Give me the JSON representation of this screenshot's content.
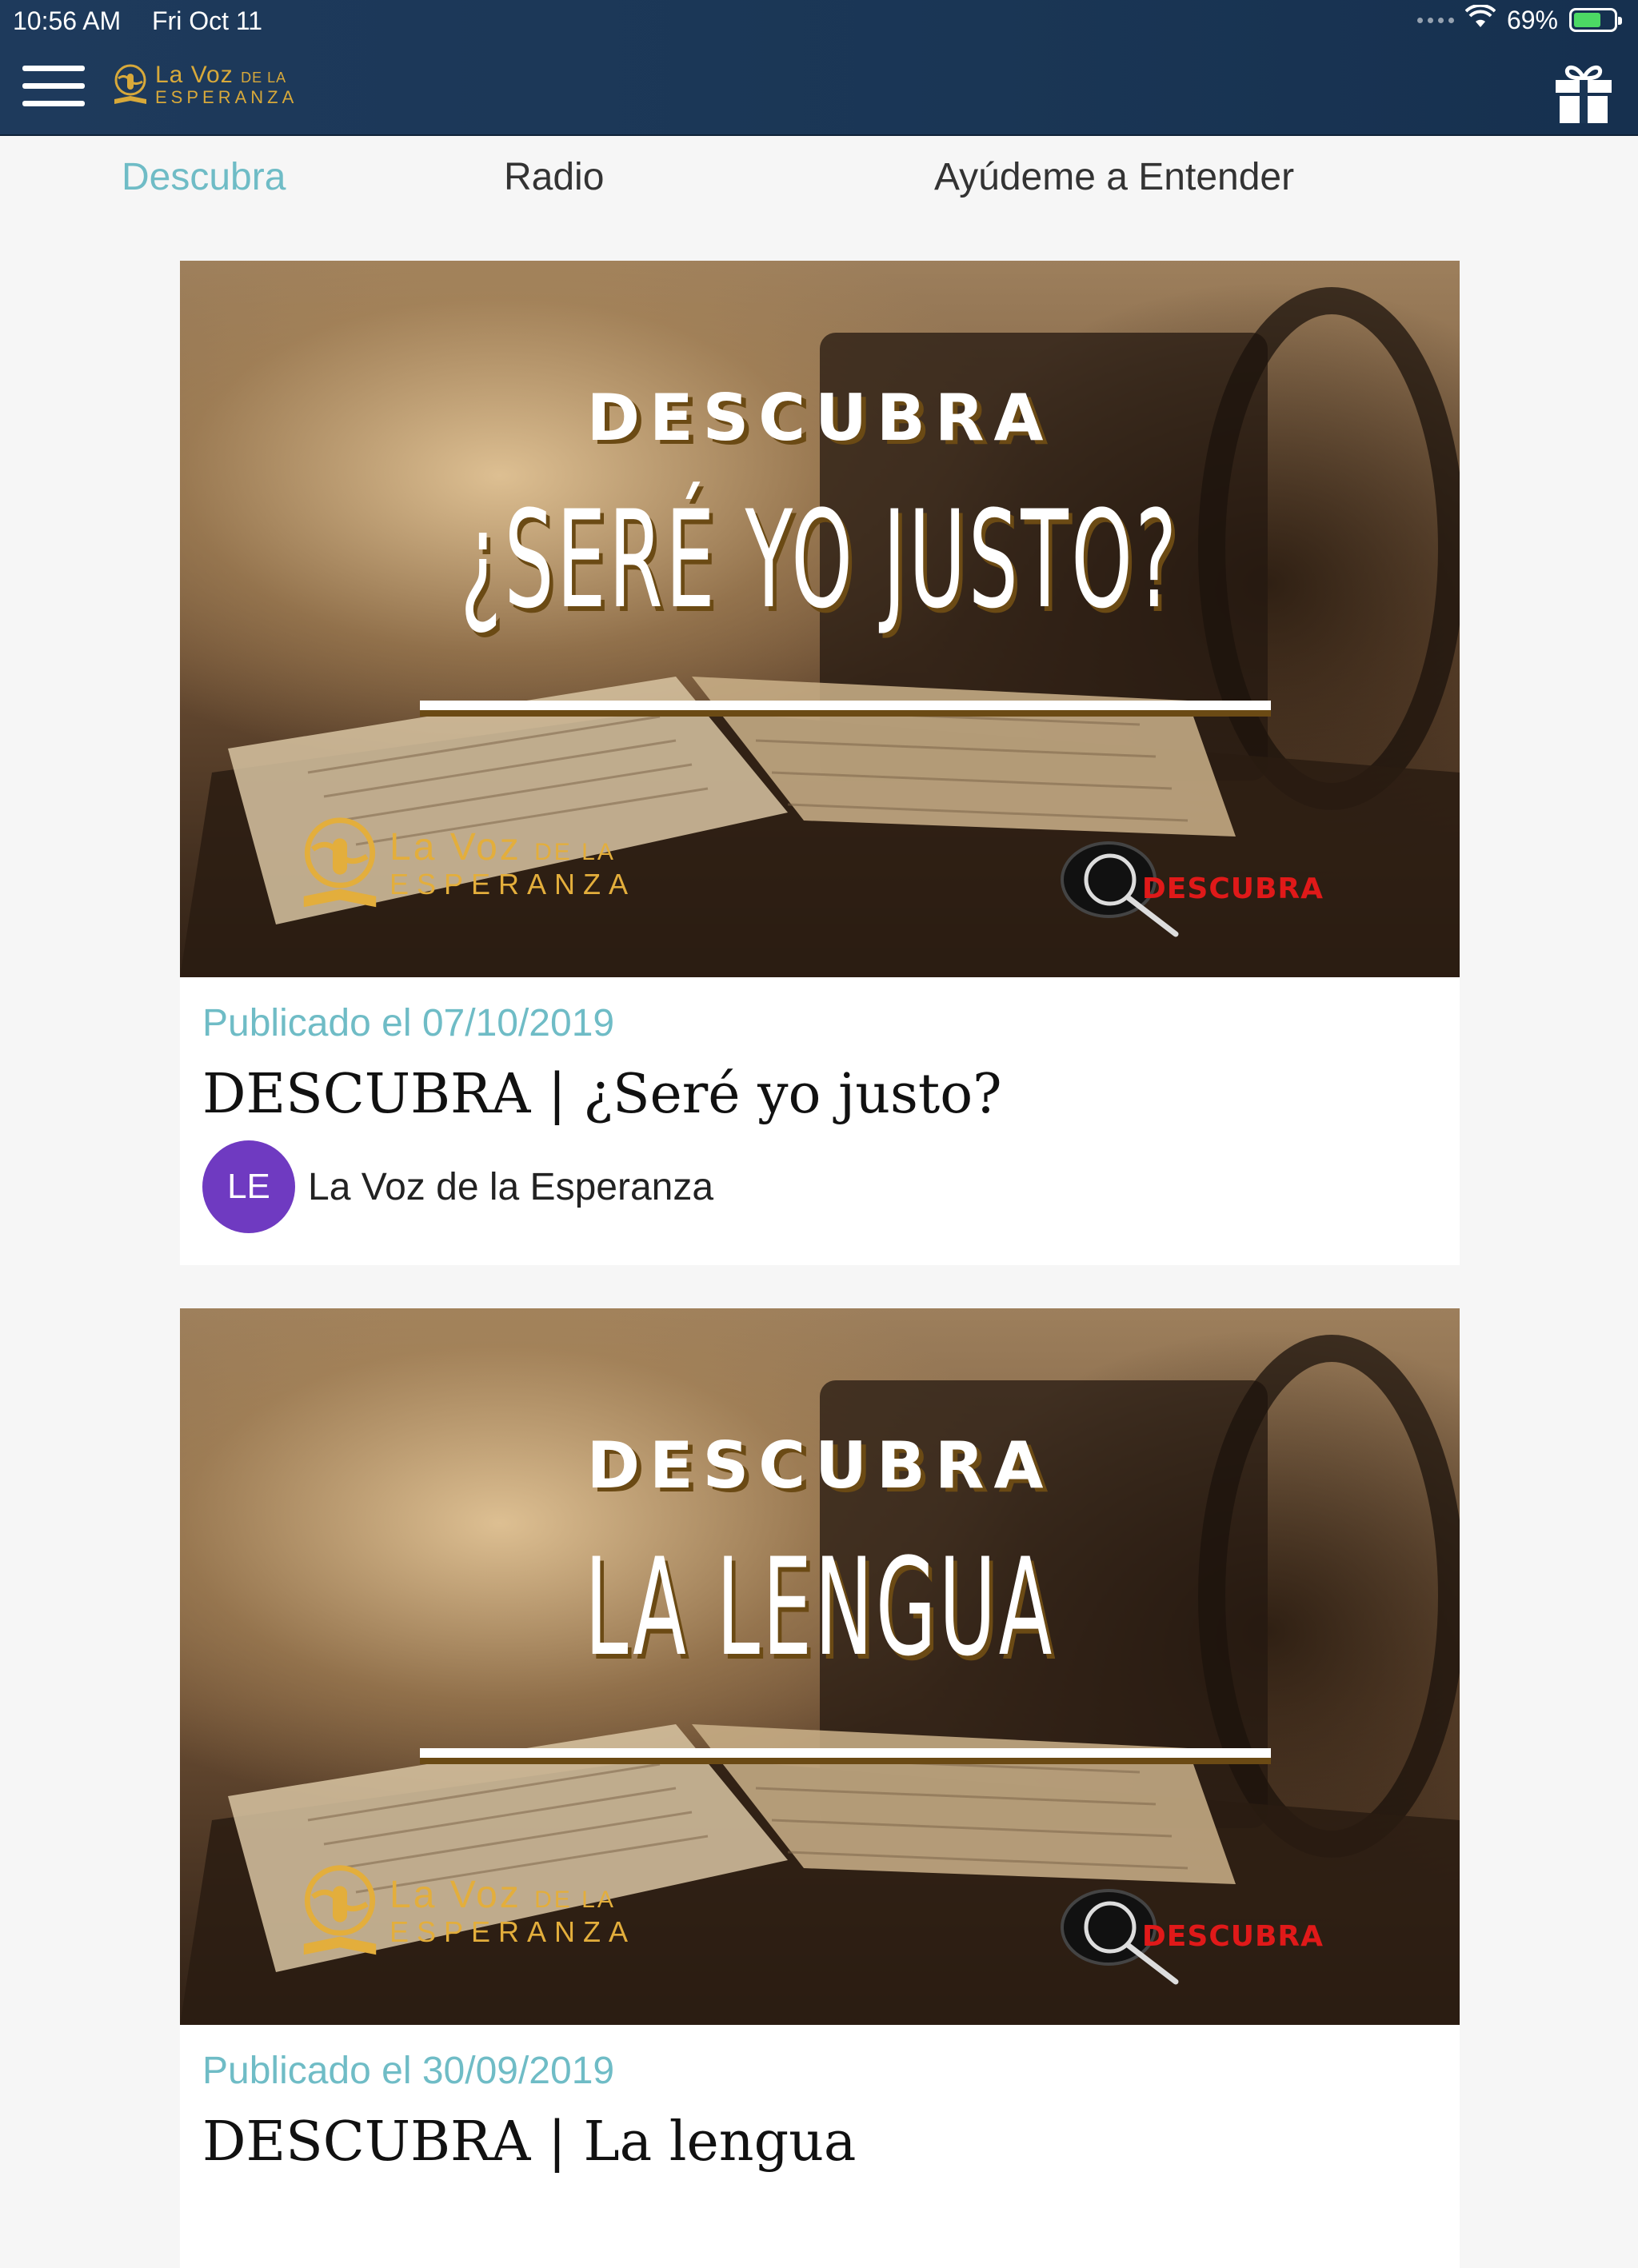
{
  "status_bar": {
    "time": "10:56 AM",
    "date": "Fri Oct 11",
    "battery": "69%",
    "battery_level": 0.69,
    "battery_color": "#4cd964"
  },
  "header": {
    "menu_icon": "hamburger-icon",
    "logo": {
      "line1": "La Voz",
      "line1_small": "DE LA",
      "line2": "ESPERANZA"
    },
    "gift_icon": "gift-icon"
  },
  "tabs": [
    {
      "label": "Descubra",
      "active": true
    },
    {
      "label": "Radio",
      "active": false
    },
    {
      "label": "Ayúdeme a Entender",
      "active": false
    }
  ],
  "theme": {
    "accent": "#6fbcc6",
    "header_bg": "#1e3a5c",
    "avatar_bg": "#6f3ac1",
    "badge_red": "#e01919",
    "gold": "#e3ae3c"
  },
  "posts": [
    {
      "thumbnail": {
        "kicker": "DESCUBRA",
        "title": "¿SERÉ YO JUSTO?",
        "logo_line1": "La Voz",
        "logo_line1_small": "DE LA",
        "logo_line2": "ESPERANZA",
        "badge": "DESCUBRA"
      },
      "published": "Publicado el 07/10/2019",
      "title": "DESCUBRA | ¿Seré yo justo?",
      "author_initials": "LE",
      "author": "La Voz de la Esperanza"
    },
    {
      "thumbnail": {
        "kicker": "DESCUBRA",
        "title": "LA LENGUA",
        "logo_line1": "La Voz",
        "logo_line1_small": "DE LA",
        "logo_line2": "ESPERANZA",
        "badge": "DESCUBRA"
      },
      "published": "Publicado el 30/09/2019",
      "title": "DESCUBRA | La lengua"
    }
  ]
}
